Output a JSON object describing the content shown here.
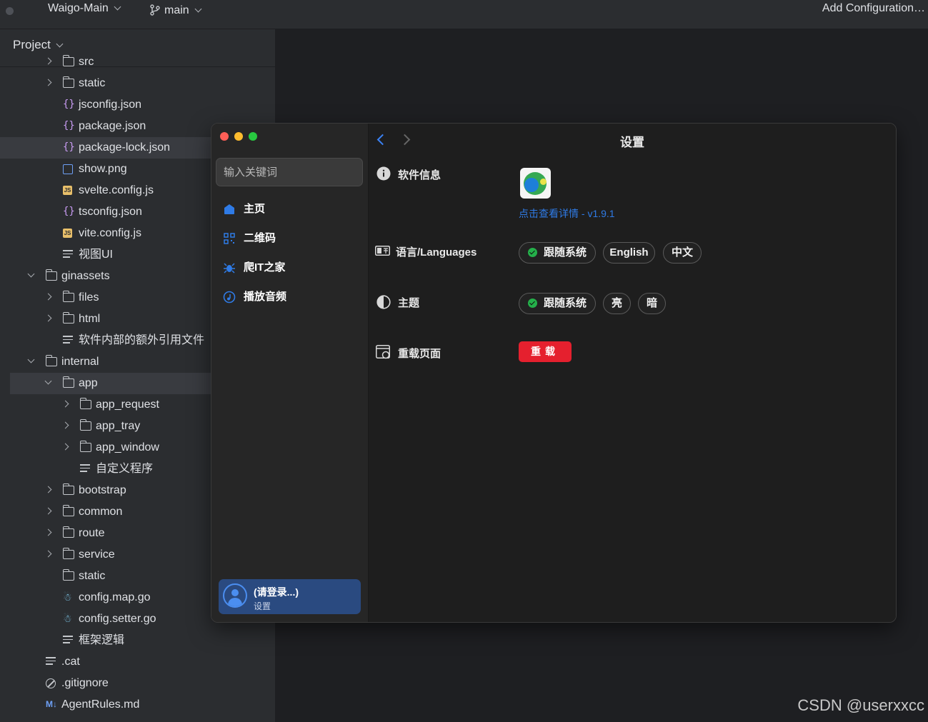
{
  "ide": {
    "project_name": "Waigo-Main",
    "branch": "main",
    "add_configuration": "Add Configuration…"
  },
  "project_panel": {
    "title": "Project",
    "items": [
      {
        "label": "src",
        "type": "folder",
        "depth": 1,
        "arrow": "right"
      },
      {
        "label": "static",
        "type": "folder",
        "depth": 1,
        "arrow": "right"
      },
      {
        "label": "jsconfig.json",
        "type": "json",
        "depth": 1
      },
      {
        "label": "package.json",
        "type": "json",
        "depth": 1
      },
      {
        "label": "package-lock.json",
        "type": "json",
        "depth": 1,
        "selected": true
      },
      {
        "label": "show.png",
        "type": "image",
        "depth": 1
      },
      {
        "label": "svelte.config.js",
        "type": "js",
        "depth": 1
      },
      {
        "label": "tsconfig.json",
        "type": "json",
        "depth": 1
      },
      {
        "label": "vite.config.js",
        "type": "js",
        "depth": 1
      },
      {
        "label": "视图UI",
        "type": "text",
        "depth": 1
      },
      {
        "label": "ginassets",
        "type": "folder",
        "depth": 0,
        "arrow": "down"
      },
      {
        "label": "files",
        "type": "folder",
        "depth": 1,
        "arrow": "right"
      },
      {
        "label": "html",
        "type": "folder",
        "depth": 1,
        "arrow": "right"
      },
      {
        "label": "软件内部的额外引用文件",
        "type": "text",
        "depth": 1
      },
      {
        "label": "internal",
        "type": "folder",
        "depth": 0,
        "arrow": "down"
      },
      {
        "label": "app",
        "type": "folder",
        "depth": 1,
        "arrow": "down",
        "selected": true
      },
      {
        "label": "app_request",
        "type": "folder",
        "depth": 2,
        "arrow": "right"
      },
      {
        "label": "app_tray",
        "type": "folder",
        "depth": 2,
        "arrow": "right"
      },
      {
        "label": "app_window",
        "type": "folder",
        "depth": 2,
        "arrow": "right"
      },
      {
        "label": "自定义程序",
        "type": "text",
        "depth": 2
      },
      {
        "label": "bootstrap",
        "type": "folder",
        "depth": 1,
        "arrow": "right"
      },
      {
        "label": "common",
        "type": "folder",
        "depth": 1,
        "arrow": "right"
      },
      {
        "label": "route",
        "type": "folder",
        "depth": 1,
        "arrow": "right"
      },
      {
        "label": "service",
        "type": "folder",
        "depth": 1,
        "arrow": "right"
      },
      {
        "label": "static",
        "type": "folder",
        "depth": 1
      },
      {
        "label": "config.map.go",
        "type": "go",
        "depth": 1
      },
      {
        "label": "config.setter.go",
        "type": "go",
        "depth": 1
      },
      {
        "label": "框架逻辑",
        "type": "text",
        "depth": 1
      },
      {
        "label": ".cat",
        "type": "text",
        "depth": 0
      },
      {
        "label": ".gitignore",
        "type": "ignore",
        "depth": 0
      },
      {
        "label": "AgentRules.md",
        "type": "md",
        "depth": 0
      }
    ]
  },
  "app": {
    "search_placeholder": "输入关键词",
    "nav": [
      {
        "label": "主页",
        "icon": "home-icon"
      },
      {
        "label": "二维码",
        "icon": "qrcode-icon"
      },
      {
        "label": "爬IT之家",
        "icon": "bug-icon"
      },
      {
        "label": "播放音频",
        "icon": "music-icon"
      }
    ],
    "user": {
      "name": "(请登录...)",
      "sub": "设置"
    },
    "title": "设置",
    "software_info": {
      "label": "软件信息",
      "link": "点击查看详情 - v1.9.1"
    },
    "language": {
      "label": "语言/Languages",
      "options": [
        "跟随系统",
        "English",
        "中文"
      ],
      "selected": "跟随系统"
    },
    "theme": {
      "label": "主题",
      "options": [
        "跟随系统",
        "亮",
        "暗"
      ],
      "selected": "跟随系统"
    },
    "reload": {
      "label": "重载页面",
      "button": "重载"
    }
  },
  "watermark": "CSDN @userxxcc",
  "colors": {
    "accent": "#3b82f6",
    "danger": "#e5202e",
    "success": "#24b04a"
  }
}
